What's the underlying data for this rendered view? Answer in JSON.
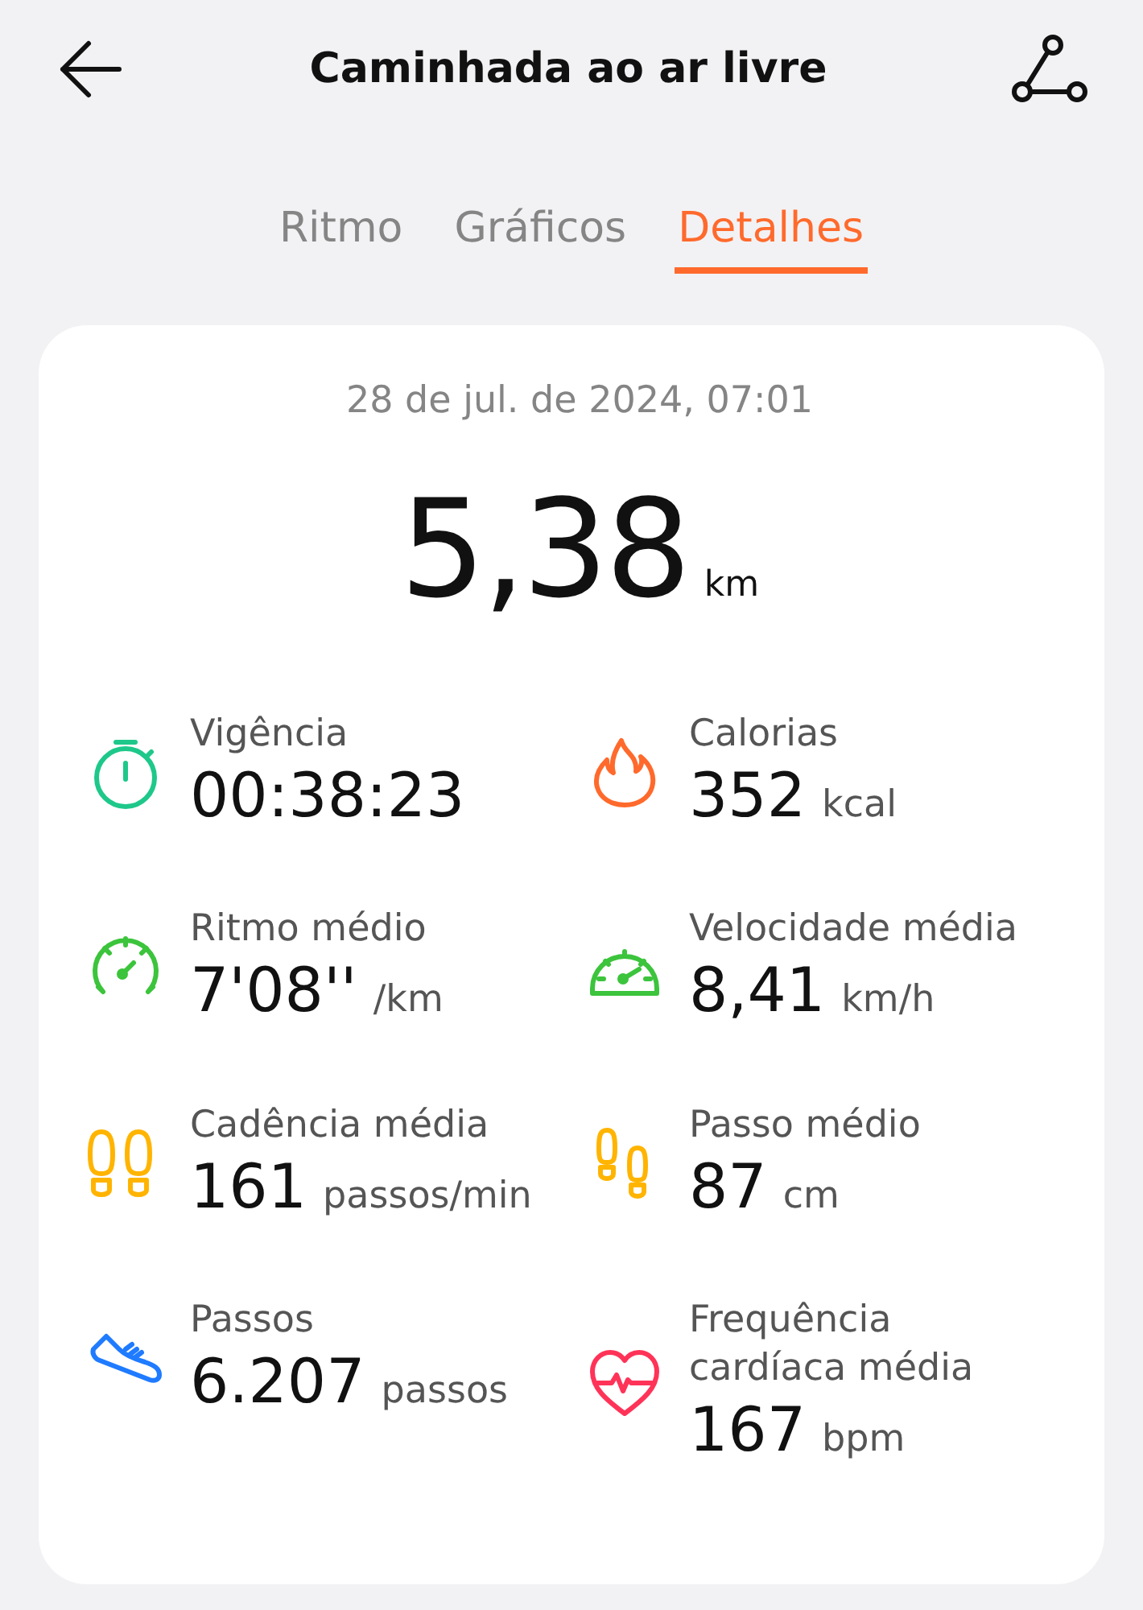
{
  "header": {
    "title": "Caminhada ao ar livre"
  },
  "tabs": [
    {
      "label": "Ritmo",
      "selected": false
    },
    {
      "label": "Gráficos",
      "selected": false
    },
    {
      "label": "Detalhes",
      "selected": true
    }
  ],
  "summary": {
    "date": "28 de jul. de 2024, 07:01",
    "distance": "5,38",
    "unit": "km"
  },
  "stats": [
    {
      "kind": "stopwatch",
      "color": "#1ec88a",
      "label": "Vigência",
      "value": "00:38:23"
    },
    {
      "kind": "flame",
      "color": "#ff6a2c",
      "label": "Calorias",
      "value": "352",
      "unit": "kcal"
    },
    {
      "kind": "gauge",
      "color": "#3cc43c",
      "label": "Ritmo médio",
      "value": "7'08''",
      "unit": "/km"
    },
    {
      "kind": "speedometer",
      "color": "#3cc43c",
      "label": "Velocidade média",
      "value": "8,41",
      "unit": "km/h"
    },
    {
      "kind": "footprints",
      "color": "#ffb400",
      "label": "Cadência média",
      "value": "161",
      "unit": "passos/min"
    },
    {
      "kind": "footprints-offset",
      "color": "#ffb400",
      "label": "Passo médio",
      "value": "87",
      "unit": "cm"
    },
    {
      "kind": "shoe",
      "color": "#1f7bff",
      "label": "Passos",
      "value": "6.207",
      "unit": "passos"
    },
    {
      "kind": "heart",
      "color": "#ff3358",
      "label": "Frequência cardíaca média",
      "value": "167",
      "unit": "bpm"
    }
  ]
}
